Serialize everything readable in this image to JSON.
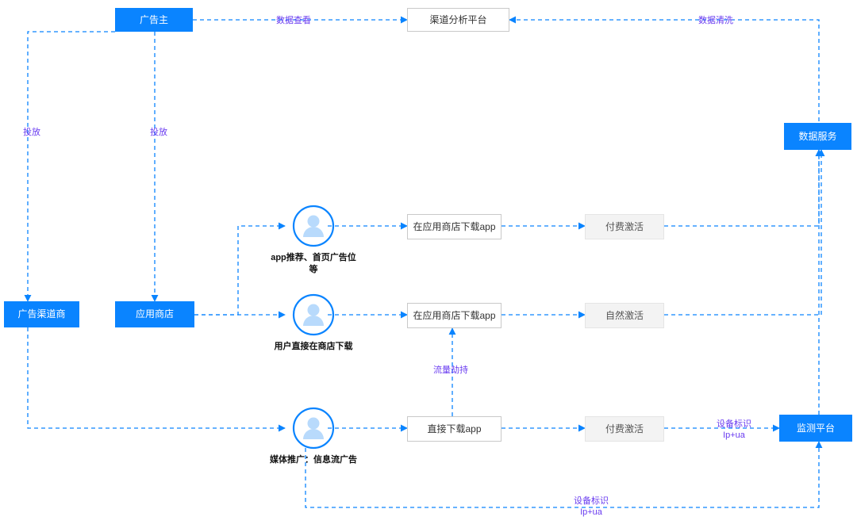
{
  "colors": {
    "primary": "#0a84ff",
    "label": "#6a3cf0"
  },
  "nodes": {
    "advertiser": "广告主",
    "analysis_platform": "渠道分析平台",
    "data_service": "数据服务",
    "ad_channel": "广告渠道商",
    "app_store": "应用商店",
    "download_store_1": "在应用商店下载app",
    "download_store_2": "在应用商店下载app",
    "download_direct": "直接下载app",
    "paid_activation_1": "付费激活",
    "natural_activation": "自然激活",
    "paid_activation_2": "付费激活",
    "monitor_platform": "监测平台"
  },
  "personas": {
    "p1": "app推荐、首页广告位\n等",
    "p2": "用户直接在商店下载",
    "p3": "媒体推广：信息流广告"
  },
  "edge_labels": {
    "data_view": "数据查看",
    "data_clean": "数据清洗",
    "deliver_left": "投放",
    "deliver_mid": "投放",
    "traffic_hijack": "流量劫持",
    "device_id_1": "设备标识\nIp+ua",
    "device_id_2": "设备标识\nIp+ua"
  }
}
